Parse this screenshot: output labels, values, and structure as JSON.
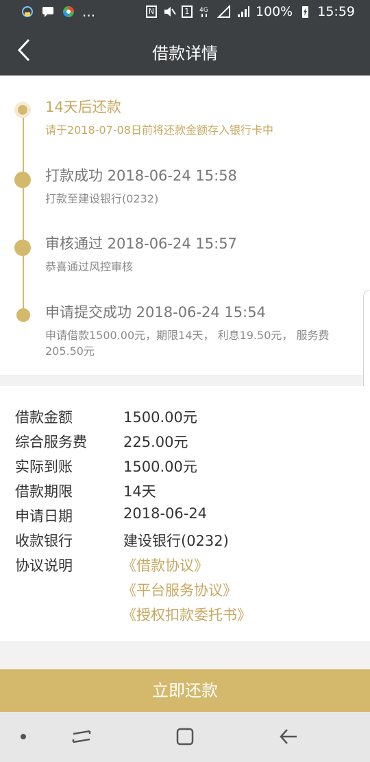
{
  "status_bar": {
    "battery": "100%",
    "time": "15:59",
    "overflow": "..."
  },
  "header": {
    "title": "借款详情"
  },
  "timeline": [
    {
      "title": "14天后还款",
      "desc": "请于2018-07-08日前将还款金额存入银行卡中",
      "active": true
    },
    {
      "title": "打款成功 2018-06-24 15:58",
      "desc": "打款至建设银行(0232)"
    },
    {
      "title": "审核通过 2018-06-24 15:57",
      "desc": "恭喜通过风控审核"
    },
    {
      "title": "申请提交成功 2018-06-24 15:54",
      "desc": "申请借款1500.00元，期限14天， 利息19.50元， 服务费205.50元"
    }
  ],
  "details": {
    "rows": [
      {
        "label": "借款金额",
        "value": "1500.00元"
      },
      {
        "label": "综合服务费",
        "value": "225.00元"
      },
      {
        "label": "实际到账",
        "value": "1500.00元"
      },
      {
        "label": "借款期限",
        "value": "14天"
      },
      {
        "label": "申请日期",
        "value": "2018-06-24"
      },
      {
        "label": "收款银行",
        "value": "建设银行(0232)"
      },
      {
        "label": "协议说明",
        "value": ""
      }
    ],
    "agreements": [
      "《借款协议》",
      "《平台服务协议》",
      "《授权扣款委托书》"
    ]
  },
  "actions": {
    "repay_label": "立即还款"
  },
  "colors": {
    "accent": "#d4b96c",
    "header_bg": "#3c4043"
  }
}
